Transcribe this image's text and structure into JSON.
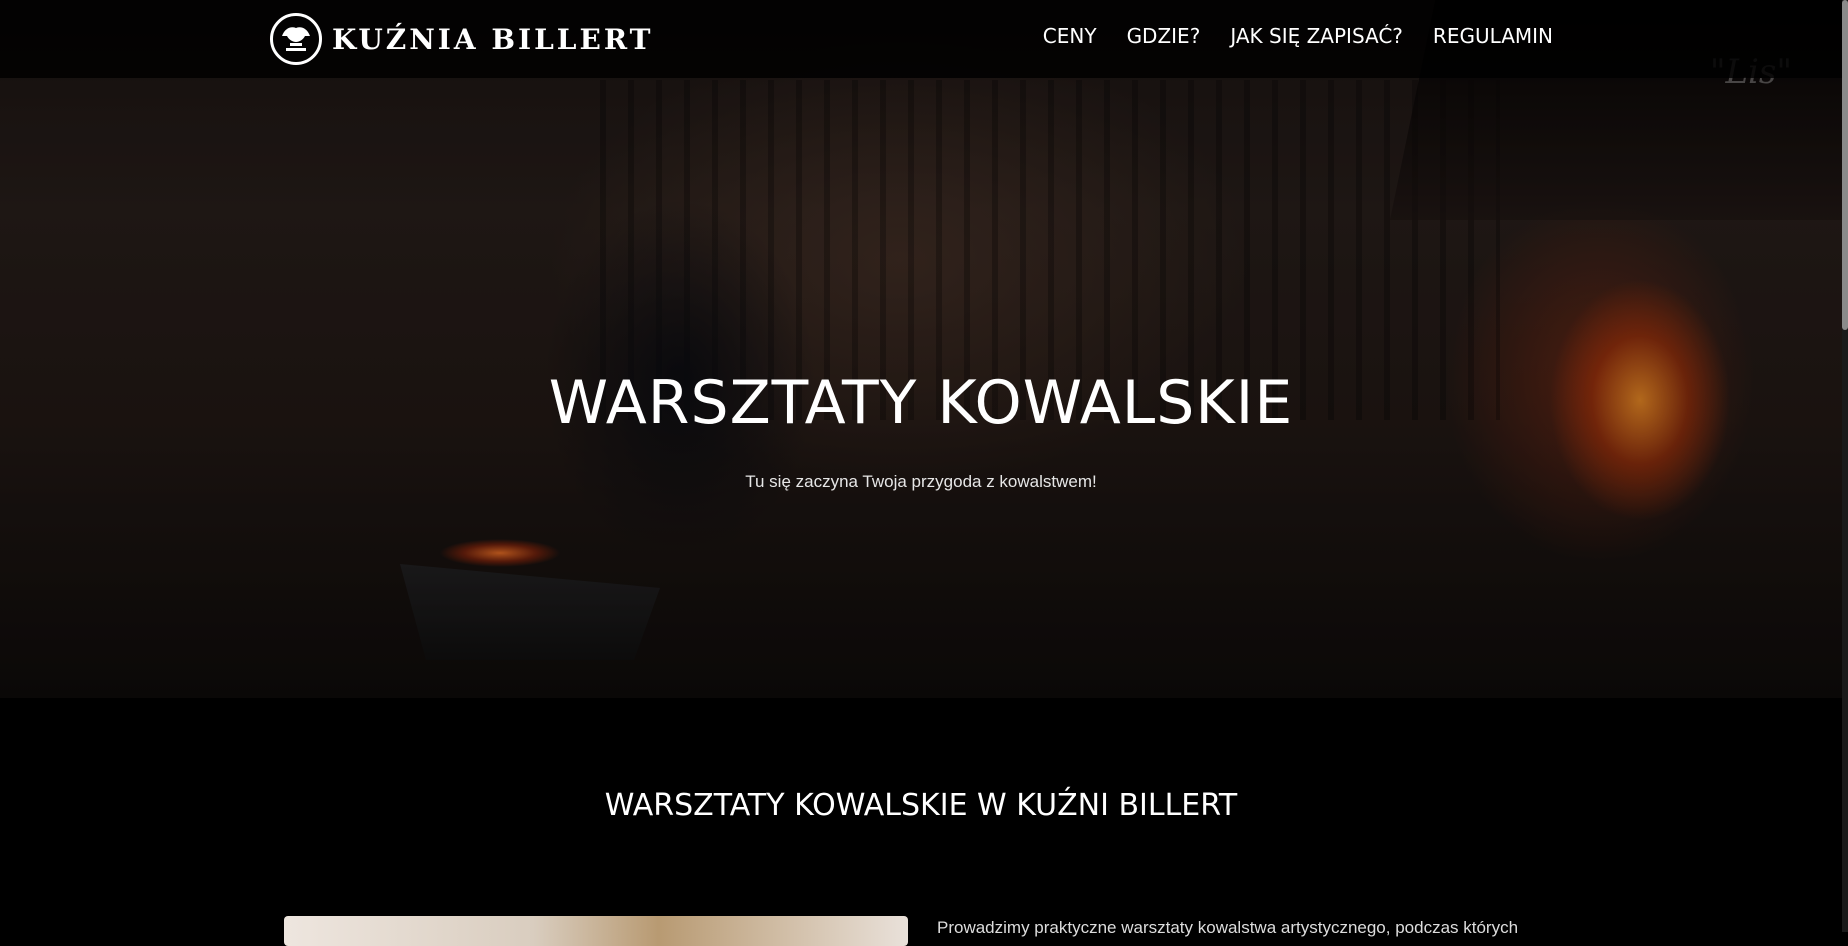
{
  "brand": {
    "logo_text": "KUŹNIA BILLERT",
    "logo_icon": "anvil-hand-emblem-icon"
  },
  "nav": {
    "items": [
      {
        "label": "CENY"
      },
      {
        "label": "GDZIE?"
      },
      {
        "label": "JAK SIĘ ZAPISAĆ?"
      },
      {
        "label": "REGULAMIN"
      }
    ]
  },
  "hero": {
    "title": "WARSZTATY KOWALSKIE",
    "subtitle": "Tu się zaczyna Twoja przygoda z kowalstwem!",
    "signature": "\"Lis\""
  },
  "section": {
    "title": "WARSZTATY KOWALSKIE W KUŹNI BILLERT",
    "text_preview": "Prowadzimy praktyczne warsztaty kowalstwa artystycznego, podczas których"
  },
  "colors": {
    "background": "#000000",
    "text": "#ffffff",
    "navbar": "#000000"
  }
}
